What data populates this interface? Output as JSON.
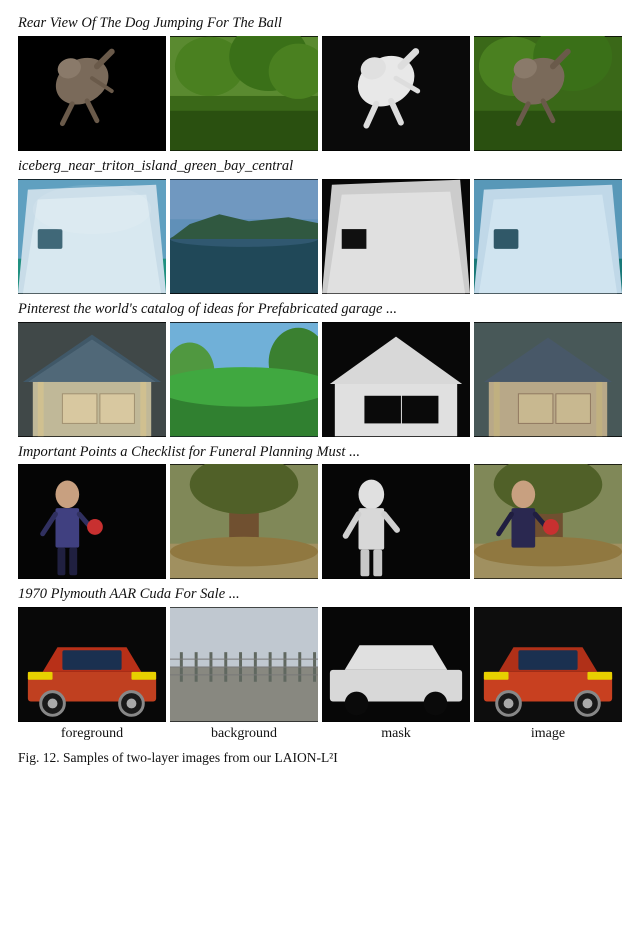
{
  "rows": [
    {
      "label": "Rear View Of The Dog Jumping For The Ball",
      "cells": [
        {
          "type": "foreground",
          "desc": "dog-black-bg"
        },
        {
          "type": "background",
          "desc": "dog-green-bg"
        },
        {
          "type": "mask",
          "desc": "dog-mask"
        },
        {
          "type": "image",
          "desc": "dog-result"
        }
      ]
    },
    {
      "label": "iceberg_near_triton_island_green_bay_central",
      "cells": [
        {
          "type": "foreground",
          "desc": "iceberg-main"
        },
        {
          "type": "background",
          "desc": "iceberg-bg"
        },
        {
          "type": "mask",
          "desc": "iceberg-mask"
        },
        {
          "type": "image",
          "desc": "iceberg-result"
        }
      ]
    },
    {
      "label": "Pinterest the world's catalog of ideas for Prefabricated garage ...",
      "cells": [
        {
          "type": "foreground",
          "desc": "garage-orig"
        },
        {
          "type": "background",
          "desc": "garage-bg"
        },
        {
          "type": "mask",
          "desc": "garage-mask"
        },
        {
          "type": "image",
          "desc": "garage-result"
        }
      ]
    },
    {
      "label": "Important Points a Checklist for Funeral Planning Must ...",
      "cells": [
        {
          "type": "foreground",
          "desc": "person-orig"
        },
        {
          "type": "background",
          "desc": "person-bg"
        },
        {
          "type": "mask",
          "desc": "person-mask"
        },
        {
          "type": "image",
          "desc": "person-result"
        }
      ]
    },
    {
      "label": "1970 Plymouth AAR Cuda For Sale ...",
      "cells": [
        {
          "type": "foreground",
          "desc": "car-orig"
        },
        {
          "type": "background",
          "desc": "car-bg"
        },
        {
          "type": "mask",
          "desc": "car-mask"
        },
        {
          "type": "image",
          "desc": "car-result"
        }
      ]
    }
  ],
  "col_labels": [
    "foreground",
    "background",
    "mask",
    "image"
  ],
  "fig_caption": "Fig. 12. Samples of two-layer images from our LAION-L²I"
}
